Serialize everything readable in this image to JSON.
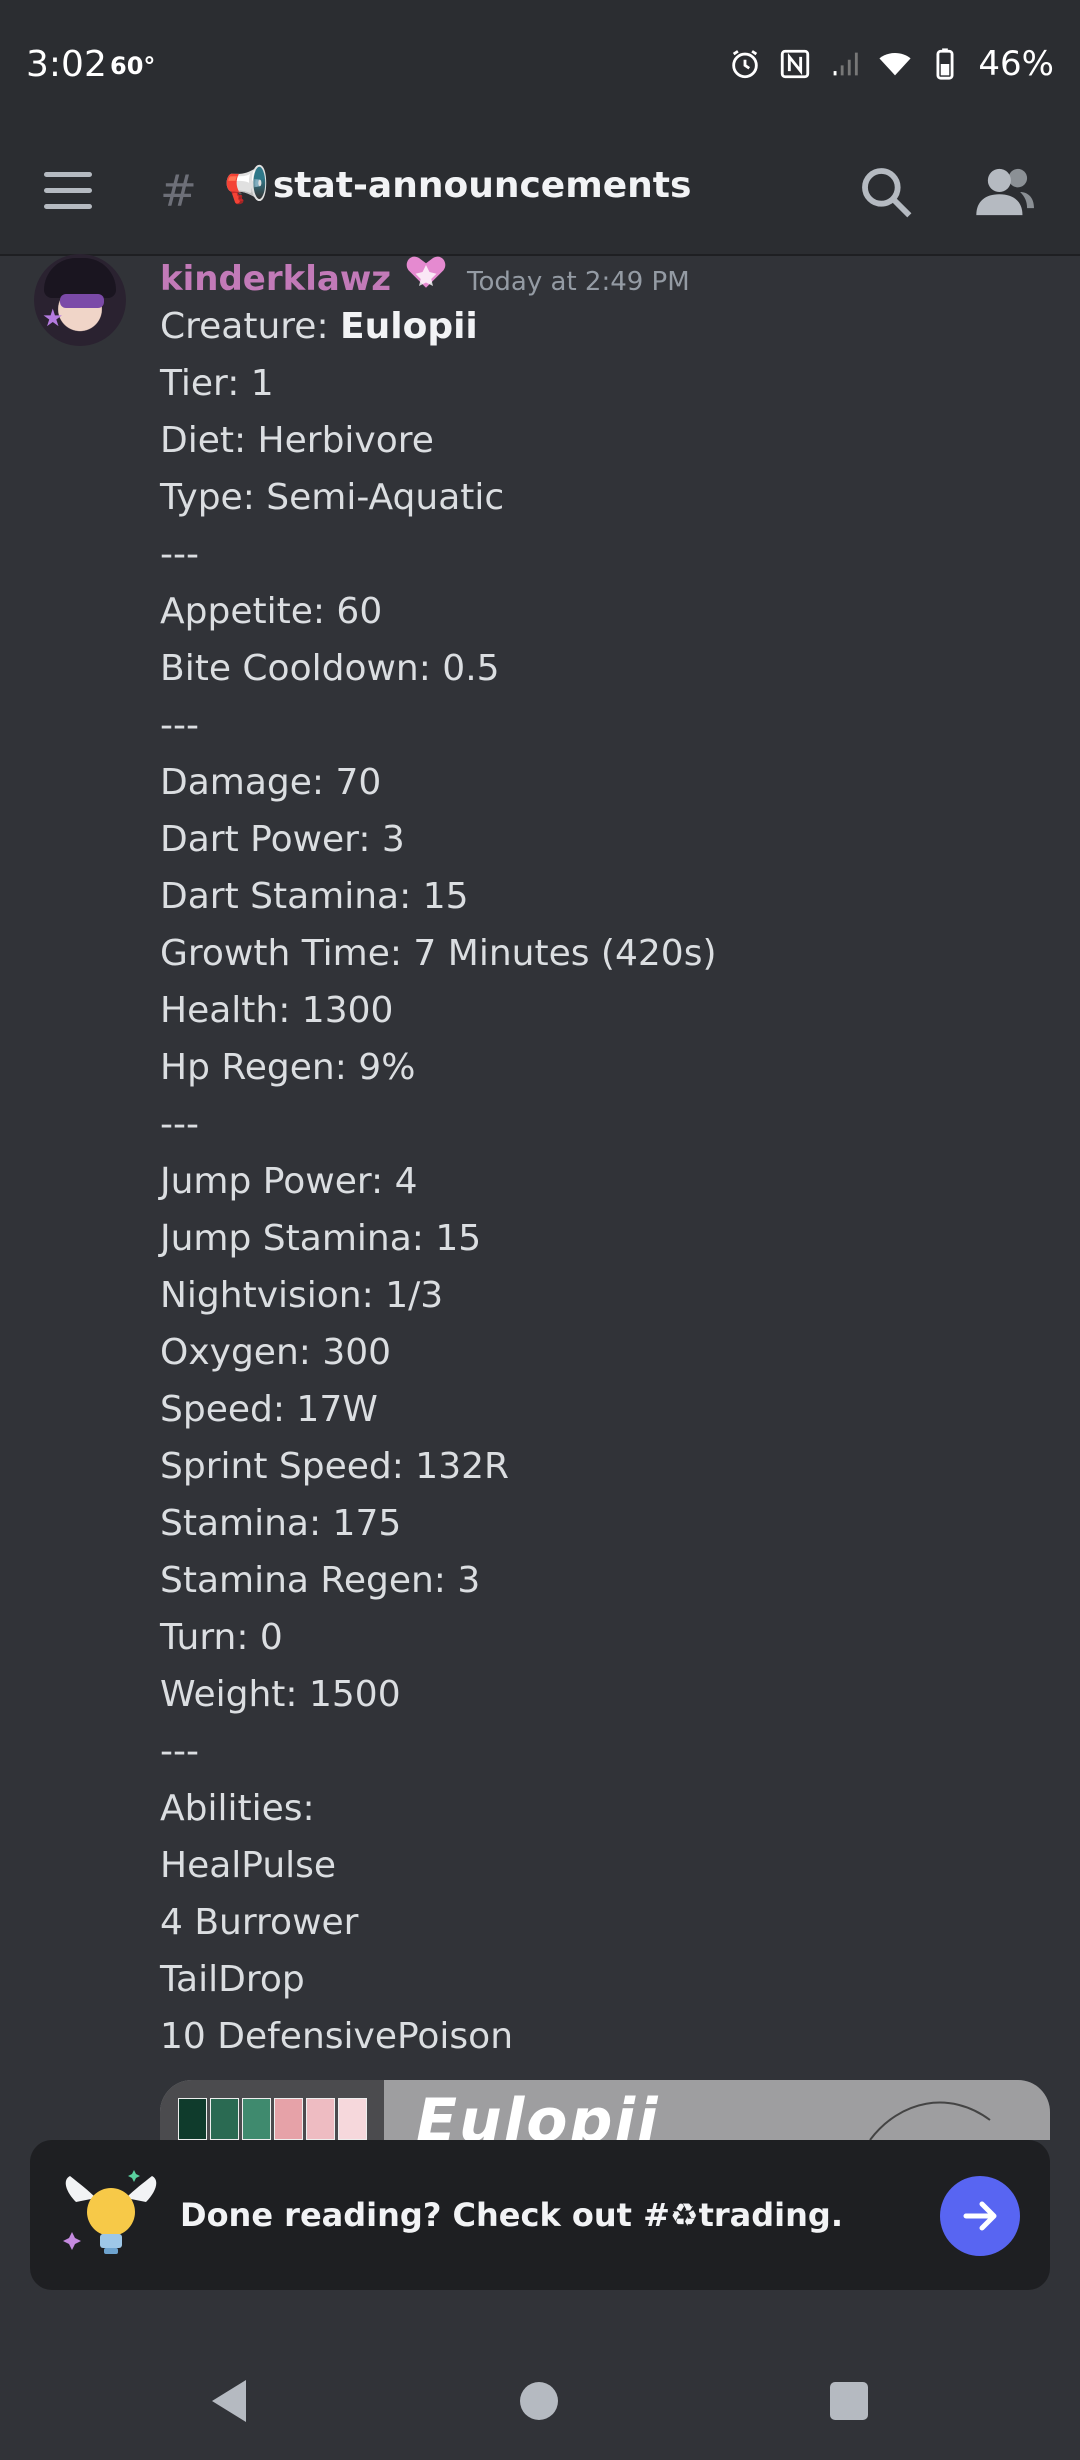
{
  "status_bar": {
    "time": "3:02",
    "temperature": "60°",
    "battery": "46%"
  },
  "app_bar": {
    "channel_emoji": "📢",
    "channel_name": "stat-announcements"
  },
  "message": {
    "username": "kinderklawz",
    "username_color": "#c27ab8",
    "timestamp": "Today at 2:49 PM",
    "creature_label": "Creature: ",
    "creature_name": "Eulopii",
    "lines": [
      "Tier: 1",
      "Diet: Herbivore",
      "Type: Semi-Aquatic",
      "---",
      "Appetite: 60",
      "Bite Cooldown: 0.5",
      "---",
      "Damage: 70",
      "Dart Power: 3",
      "Dart Stamina: 15",
      "Growth Time: 7 Minutes (420s)",
      "Health: 1300",
      "Hp Regen: 9%",
      "---",
      "Jump Power: 4",
      "Jump Stamina: 15",
      "Nightvision: 1/3",
      "Oxygen: 300",
      "Speed: 17W",
      "Sprint Speed: 132R",
      "Stamina: 175",
      "Stamina Regen: 3",
      "Turn: 0",
      "Weight: 1500",
      "---",
      "Abilities:",
      "HealPulse",
      "4 Burrower",
      "TailDrop",
      "10 DefensivePoison"
    ]
  },
  "embed": {
    "title": "Eulopii",
    "swatch_colors": [
      "#0f3b2c",
      "#2a6a52",
      "#3f8a6e",
      "#e6a2a8",
      "#eebcc2",
      "#f6d8dc"
    ]
  },
  "nudge": {
    "text": "Done reading? Check out #♻trading.",
    "accent": "#5865f2"
  },
  "icons": {
    "menu": "hamburger-icon",
    "thread": "thread-icon",
    "search": "search-icon",
    "members": "members-icon",
    "arrow": "arrow-right-icon"
  }
}
